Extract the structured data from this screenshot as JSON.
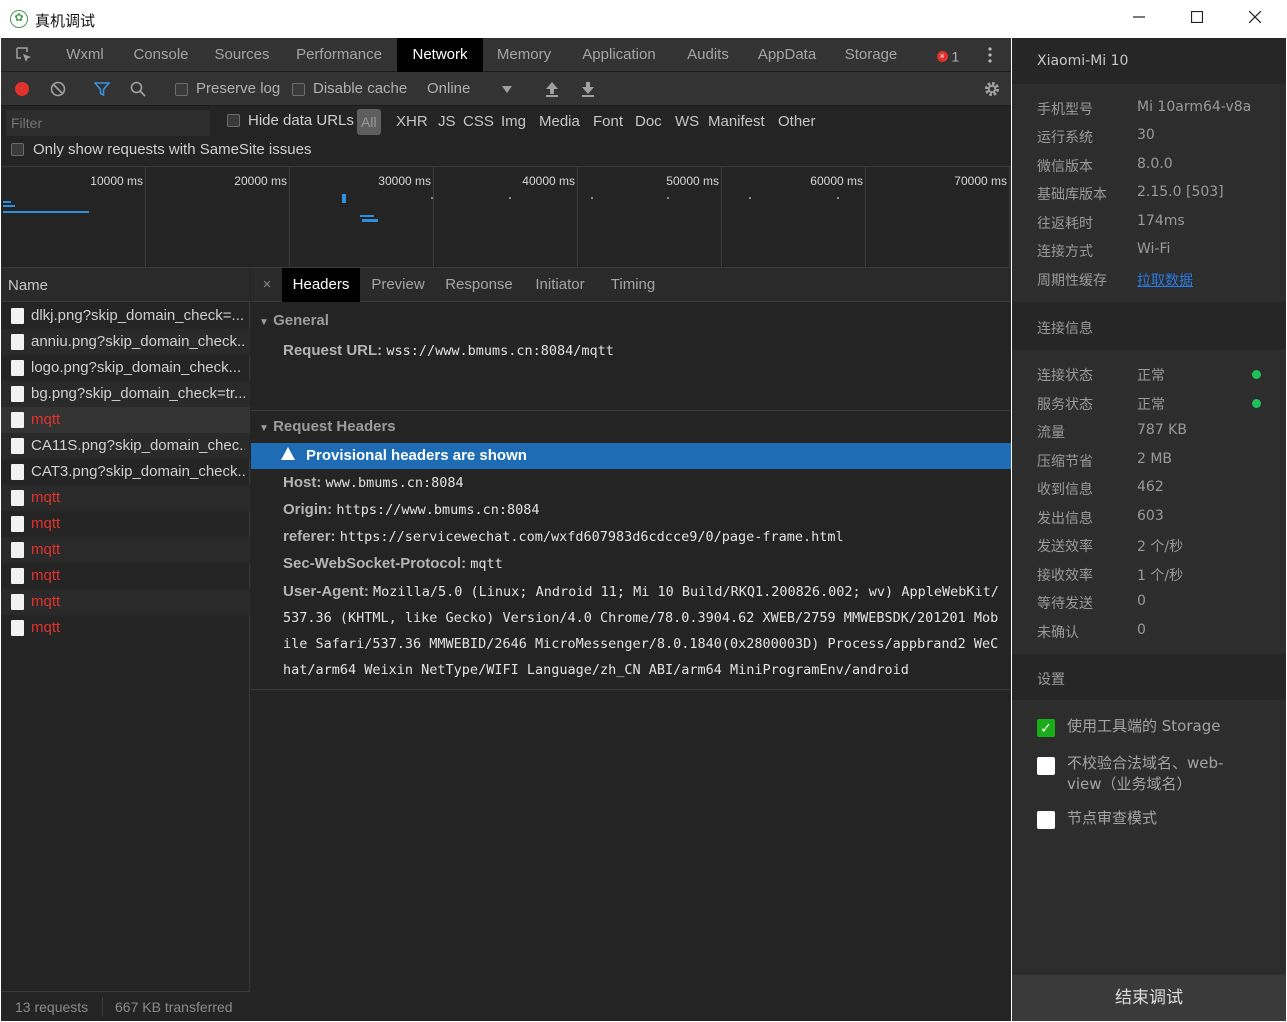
{
  "window": {
    "title": "真机调试",
    "controls": [
      "minimize-icon",
      "maximize-icon",
      "close-icon"
    ]
  },
  "tabs": [
    {
      "label": "Wxml",
      "active": false
    },
    {
      "label": "Console",
      "active": false
    },
    {
      "label": "Sources",
      "active": false
    },
    {
      "label": "Performance",
      "active": false
    },
    {
      "label": "Network",
      "active": true
    },
    {
      "label": "Memory",
      "active": false
    },
    {
      "label": "Application",
      "active": false
    },
    {
      "label": "Audits",
      "active": false
    },
    {
      "label": "AppData",
      "active": false
    },
    {
      "label": "Storage",
      "active": false
    }
  ],
  "error_count": "1",
  "toolbar": {
    "preserve_log": "Preserve log",
    "disable_cache": "Disable cache",
    "throttling": "Online"
  },
  "filter": {
    "placeholder": "Filter",
    "hide_data_urls": "Hide data URLs",
    "types": [
      "All",
      "XHR",
      "JS",
      "CSS",
      "Img",
      "Media",
      "Font",
      "Doc",
      "WS",
      "Manifest",
      "Other"
    ],
    "active_type": "All",
    "samesite": "Only show requests with SameSite issues"
  },
  "overview": {
    "ticks": [
      "10000 ms",
      "20000 ms",
      "30000 ms",
      "40000 ms",
      "50000 ms",
      "60000 ms",
      "70000 ms"
    ]
  },
  "requests": {
    "header": "Name",
    "items": [
      {
        "name": "dlkj.png?skip_domain_check=...",
        "error": false
      },
      {
        "name": "anniu.png?skip_domain_check...",
        "error": false
      },
      {
        "name": "logo.png?skip_domain_check...",
        "error": false
      },
      {
        "name": "bg.png?skip_domain_check=tr...",
        "error": false
      },
      {
        "name": "mqtt",
        "error": true
      },
      {
        "name": "CA11S.png?skip_domain_chec...",
        "error": false
      },
      {
        "name": "CAT3.png?skip_domain_check...",
        "error": false
      },
      {
        "name": "mqtt",
        "error": true
      },
      {
        "name": "mqtt",
        "error": true
      },
      {
        "name": "mqtt",
        "error": true
      },
      {
        "name": "mqtt",
        "error": true
      },
      {
        "name": "mqtt",
        "error": true
      },
      {
        "name": "mqtt",
        "error": true
      }
    ],
    "status_count": "13 requests",
    "status_transferred": "667 KB transferred"
  },
  "detail": {
    "tabs": [
      "Headers",
      "Preview",
      "Response",
      "Initiator",
      "Timing"
    ],
    "active_tab": "Headers",
    "general_title": "General",
    "request_url_key": "Request URL:",
    "request_url": "wss://www.bmums.cn:8084/mqtt",
    "request_headers_title": "Request Headers",
    "provisional": "Provisional headers are shown",
    "headers": [
      {
        "key": "Host:",
        "value": "www.bmums.cn:8084"
      },
      {
        "key": "Origin:",
        "value": "https://www.bmums.cn:8084"
      },
      {
        "key": "referer:",
        "value": "https://servicewechat.com/wxfd607983d6cdcce9/0/page-frame.html"
      },
      {
        "key": "Sec-WebSocket-Protocol:",
        "value": "mqtt"
      },
      {
        "key": "User-Agent:",
        "value": "Mozilla/5.0 (Linux; Android 11; Mi 10 Build/RKQ1.200826.002; wv) AppleWebKit/"
      }
    ],
    "ua_continued": [
      "537.36 (KHTML, like Gecko) Version/4.0 Chrome/78.0.3904.62 XWEB/2759 MMWEBSDK/201201 Mob",
      "ile Safari/537.36 MMWEBID/2646 MicroMessenger/8.0.1840(0x2800003D) Process/appbrand2 WeC",
      "hat/arm64 Weixin NetType/WIFI Language/zh_CN ABI/arm64 MiniProgramEnv/android"
    ]
  },
  "device": {
    "name": "Xiaomi-Mi 10",
    "info": [
      {
        "key": "手机型号",
        "value": "Mi 10arm64-v8a"
      },
      {
        "key": "运行系统",
        "value": "30"
      },
      {
        "key": "微信版本",
        "value": "8.0.0"
      },
      {
        "key": "基础库版本",
        "value": "2.15.0 [503]"
      },
      {
        "key": "往返耗时",
        "value": "174ms"
      },
      {
        "key": "连接方式",
        "value": "Wi-Fi"
      },
      {
        "key": "周期性缓存",
        "value": "拉取数据"
      }
    ],
    "link_color": "#2a7ae2",
    "conn_title": "连接信息",
    "conn": [
      {
        "key": "连接状态",
        "value": "正常",
        "dot": true
      },
      {
        "key": "服务状态",
        "value": "正常",
        "dot": true
      },
      {
        "key": "流量",
        "value": "787 KB",
        "dot": false
      },
      {
        "key": "压缩节省",
        "value": "2 MB",
        "dot": false
      },
      {
        "key": "收到信息",
        "value": "462",
        "dot": false
      },
      {
        "key": "发出信息",
        "value": "603",
        "dot": false
      },
      {
        "key": "发送效率",
        "value": "2 个/秒",
        "dot": false
      },
      {
        "key": "接收效率",
        "value": "1 个/秒",
        "dot": false
      },
      {
        "key": "等待发送",
        "value": "0",
        "dot": false
      },
      {
        "key": "未确认",
        "value": "0",
        "dot": false
      }
    ],
    "settings_title": "设置",
    "settings": [
      {
        "label": "使用工具端的 Storage",
        "checked": true
      },
      {
        "label": "不校验合法域名、web-view（业务域名）",
        "checked": false
      },
      {
        "label": "节点审查模式",
        "checked": false
      }
    ],
    "end_button": "结束调试"
  }
}
